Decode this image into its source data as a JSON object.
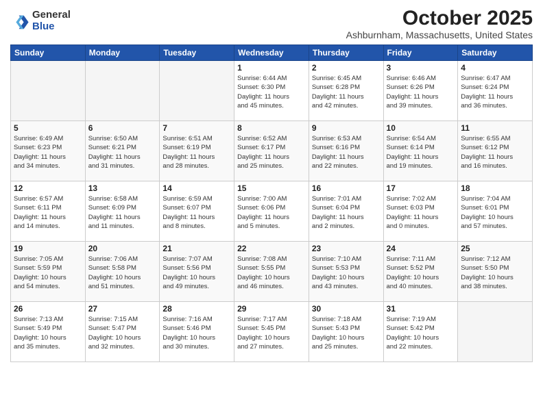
{
  "header": {
    "logo_general": "General",
    "logo_blue": "Blue",
    "month_title": "October 2025",
    "location": "Ashburnham, Massachusetts, United States"
  },
  "weekdays": [
    "Sunday",
    "Monday",
    "Tuesday",
    "Wednesday",
    "Thursday",
    "Friday",
    "Saturday"
  ],
  "weeks": [
    [
      {
        "day": "",
        "info": ""
      },
      {
        "day": "",
        "info": ""
      },
      {
        "day": "",
        "info": ""
      },
      {
        "day": "1",
        "info": "Sunrise: 6:44 AM\nSunset: 6:30 PM\nDaylight: 11 hours\nand 45 minutes."
      },
      {
        "day": "2",
        "info": "Sunrise: 6:45 AM\nSunset: 6:28 PM\nDaylight: 11 hours\nand 42 minutes."
      },
      {
        "day": "3",
        "info": "Sunrise: 6:46 AM\nSunset: 6:26 PM\nDaylight: 11 hours\nand 39 minutes."
      },
      {
        "day": "4",
        "info": "Sunrise: 6:47 AM\nSunset: 6:24 PM\nDaylight: 11 hours\nand 36 minutes."
      }
    ],
    [
      {
        "day": "5",
        "info": "Sunrise: 6:49 AM\nSunset: 6:23 PM\nDaylight: 11 hours\nand 34 minutes."
      },
      {
        "day": "6",
        "info": "Sunrise: 6:50 AM\nSunset: 6:21 PM\nDaylight: 11 hours\nand 31 minutes."
      },
      {
        "day": "7",
        "info": "Sunrise: 6:51 AM\nSunset: 6:19 PM\nDaylight: 11 hours\nand 28 minutes."
      },
      {
        "day": "8",
        "info": "Sunrise: 6:52 AM\nSunset: 6:17 PM\nDaylight: 11 hours\nand 25 minutes."
      },
      {
        "day": "9",
        "info": "Sunrise: 6:53 AM\nSunset: 6:16 PM\nDaylight: 11 hours\nand 22 minutes."
      },
      {
        "day": "10",
        "info": "Sunrise: 6:54 AM\nSunset: 6:14 PM\nDaylight: 11 hours\nand 19 minutes."
      },
      {
        "day": "11",
        "info": "Sunrise: 6:55 AM\nSunset: 6:12 PM\nDaylight: 11 hours\nand 16 minutes."
      }
    ],
    [
      {
        "day": "12",
        "info": "Sunrise: 6:57 AM\nSunset: 6:11 PM\nDaylight: 11 hours\nand 14 minutes."
      },
      {
        "day": "13",
        "info": "Sunrise: 6:58 AM\nSunset: 6:09 PM\nDaylight: 11 hours\nand 11 minutes."
      },
      {
        "day": "14",
        "info": "Sunrise: 6:59 AM\nSunset: 6:07 PM\nDaylight: 11 hours\nand 8 minutes."
      },
      {
        "day": "15",
        "info": "Sunrise: 7:00 AM\nSunset: 6:06 PM\nDaylight: 11 hours\nand 5 minutes."
      },
      {
        "day": "16",
        "info": "Sunrise: 7:01 AM\nSunset: 6:04 PM\nDaylight: 11 hours\nand 2 minutes."
      },
      {
        "day": "17",
        "info": "Sunrise: 7:02 AM\nSunset: 6:03 PM\nDaylight: 11 hours\nand 0 minutes."
      },
      {
        "day": "18",
        "info": "Sunrise: 7:04 AM\nSunset: 6:01 PM\nDaylight: 10 hours\nand 57 minutes."
      }
    ],
    [
      {
        "day": "19",
        "info": "Sunrise: 7:05 AM\nSunset: 5:59 PM\nDaylight: 10 hours\nand 54 minutes."
      },
      {
        "day": "20",
        "info": "Sunrise: 7:06 AM\nSunset: 5:58 PM\nDaylight: 10 hours\nand 51 minutes."
      },
      {
        "day": "21",
        "info": "Sunrise: 7:07 AM\nSunset: 5:56 PM\nDaylight: 10 hours\nand 49 minutes."
      },
      {
        "day": "22",
        "info": "Sunrise: 7:08 AM\nSunset: 5:55 PM\nDaylight: 10 hours\nand 46 minutes."
      },
      {
        "day": "23",
        "info": "Sunrise: 7:10 AM\nSunset: 5:53 PM\nDaylight: 10 hours\nand 43 minutes."
      },
      {
        "day": "24",
        "info": "Sunrise: 7:11 AM\nSunset: 5:52 PM\nDaylight: 10 hours\nand 40 minutes."
      },
      {
        "day": "25",
        "info": "Sunrise: 7:12 AM\nSunset: 5:50 PM\nDaylight: 10 hours\nand 38 minutes."
      }
    ],
    [
      {
        "day": "26",
        "info": "Sunrise: 7:13 AM\nSunset: 5:49 PM\nDaylight: 10 hours\nand 35 minutes."
      },
      {
        "day": "27",
        "info": "Sunrise: 7:15 AM\nSunset: 5:47 PM\nDaylight: 10 hours\nand 32 minutes."
      },
      {
        "day": "28",
        "info": "Sunrise: 7:16 AM\nSunset: 5:46 PM\nDaylight: 10 hours\nand 30 minutes."
      },
      {
        "day": "29",
        "info": "Sunrise: 7:17 AM\nSunset: 5:45 PM\nDaylight: 10 hours\nand 27 minutes."
      },
      {
        "day": "30",
        "info": "Sunrise: 7:18 AM\nSunset: 5:43 PM\nDaylight: 10 hours\nand 25 minutes."
      },
      {
        "day": "31",
        "info": "Sunrise: 7:19 AM\nSunset: 5:42 PM\nDaylight: 10 hours\nand 22 minutes."
      },
      {
        "day": "",
        "info": ""
      }
    ]
  ]
}
